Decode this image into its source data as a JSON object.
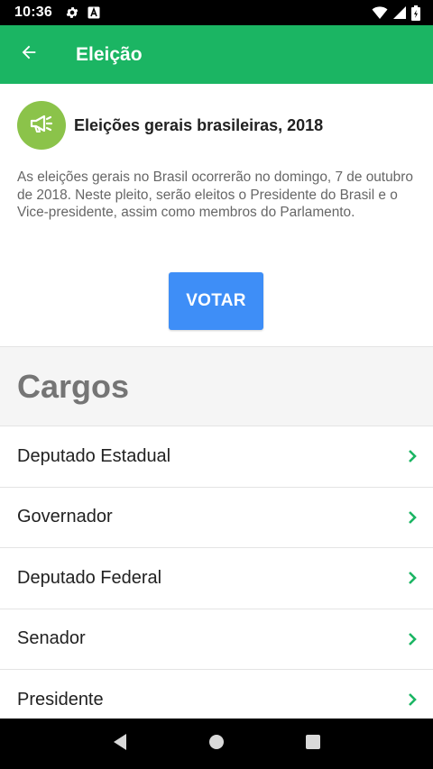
{
  "status_bar": {
    "time": "10:36",
    "left_icons": [
      "gear-icon",
      "a-badge-icon"
    ],
    "right_icons": [
      "wifi-icon",
      "signal-icon",
      "battery-icon"
    ]
  },
  "app_bar": {
    "title": "Eleição",
    "back_icon": "arrow-back-icon",
    "background_color": "#1bb563"
  },
  "election": {
    "icon": "megaphone-icon",
    "icon_background": "#8bc34a",
    "title": "Eleições gerais brasileiras, 2018",
    "description": "As eleições gerais no Brasil ocorrerão no domingo, 7 de outubro de 2018. Neste pleito, serão eleitos o Presidente do Brasil e o Vice-presidente, assim como membros do Parlamento.",
    "vote_button_label": "VOTAR",
    "vote_button_color": "#3e8ef7"
  },
  "cargos": {
    "title": "Cargos",
    "items": [
      {
        "label": "Deputado Estadual"
      },
      {
        "label": "Governador"
      },
      {
        "label": "Deputado Federal"
      },
      {
        "label": "Senador"
      },
      {
        "label": "Presidente"
      }
    ],
    "chevron_color": "#1bb563"
  },
  "nav_bar": {
    "buttons": [
      "back-triangle-icon",
      "home-circle-icon",
      "recents-square-icon"
    ]
  }
}
